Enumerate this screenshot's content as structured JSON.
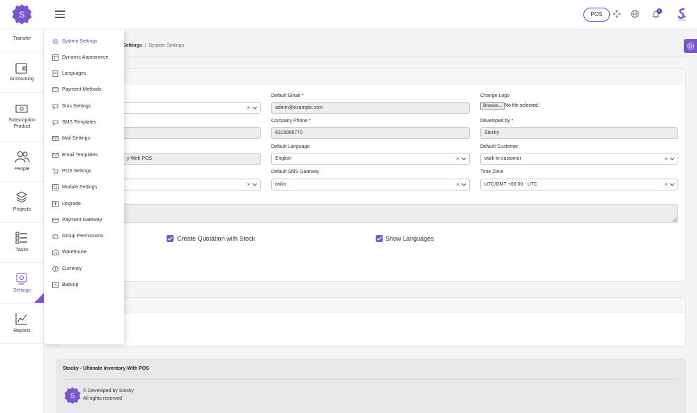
{
  "colors": {
    "accent": "#6f42c1",
    "accent_light": "#7b55d1"
  },
  "navbar": {
    "logo_letter": "S",
    "pos_label": "POS",
    "notification_count": "1"
  },
  "sidebar": {
    "items": [
      {
        "label": "Transfer",
        "icon": "transfer-icon"
      },
      {
        "label": "Accounting",
        "icon": "wallet-icon"
      },
      {
        "label": "Subscription Product",
        "icon": "money-icon"
      },
      {
        "label": "People",
        "icon": "people-icon"
      },
      {
        "label": "Projects",
        "icon": "layers-icon"
      },
      {
        "label": "Tasks",
        "icon": "tasks-icon"
      },
      {
        "label": "Settings",
        "icon": "settings-icon"
      },
      {
        "label": "Reports",
        "icon": "chart-icon"
      }
    ]
  },
  "submenu": {
    "items": [
      {
        "label": "System Settings",
        "icon": "gear-icon"
      },
      {
        "label": "Dynamic Appearance",
        "icon": "layout-icon"
      },
      {
        "label": "Languages",
        "icon": "book-icon"
      },
      {
        "label": "Payment Methods",
        "icon": "card-icon"
      },
      {
        "label": "Sms Settings",
        "icon": "chat-icon"
      },
      {
        "label": "SMS Templates",
        "icon": "chat-icon"
      },
      {
        "label": "Mail Settings",
        "icon": "mail-icon"
      },
      {
        "label": "Email Templates",
        "icon": "mail-icon"
      },
      {
        "label": "POS Settings",
        "icon": "cart-icon"
      },
      {
        "label": "Module Settings",
        "icon": "module-icon"
      },
      {
        "label": "Upgrade",
        "icon": "upgrade-icon"
      },
      {
        "label": "Payment Gateway",
        "icon": "card-icon"
      },
      {
        "label": "Group Permissions",
        "icon": "group-icon"
      },
      {
        "label": "Warehouse",
        "icon": "warehouse-icon"
      },
      {
        "label": "Currency",
        "icon": "currency-icon"
      },
      {
        "label": "Backup",
        "icon": "backup-icon"
      }
    ]
  },
  "breadcrumb": {
    "first": "Settings",
    "separator": "|",
    "last": "System Settings"
  },
  "form": {
    "left_col_partial_value": "y With POS",
    "default_email": {
      "label": "Default Email *",
      "value": "admin@example.com"
    },
    "company_phone": {
      "label": "Company Phone *",
      "value": "6315996770"
    },
    "default_language": {
      "label": "Default Language",
      "value": "English"
    },
    "default_sms_gateway": {
      "label": "Default SMS Gateway",
      "value": "twilio"
    },
    "change_logo": {
      "label": "Change Logo",
      "button": "Browse...",
      "status": "No file selected."
    },
    "developed_by": {
      "label": "Developed by *",
      "value": "Stocky"
    },
    "default_customer": {
      "label": "Default Customer",
      "value": "walk-in-customer"
    },
    "time_zone": {
      "label": "Time Zone",
      "value": "UTC/GMT +00:00 - UTC"
    },
    "clear_symbol": "×",
    "create_quotation": {
      "label": "Create Quotation with Stock",
      "checked": true
    },
    "show_languages": {
      "label": "Show Languages",
      "checked": true
    }
  },
  "footer": {
    "title": "Stocky - Ultimate Inventory With POS",
    "developed": "© Developed by Stocky",
    "rights": "All rights reserved"
  }
}
